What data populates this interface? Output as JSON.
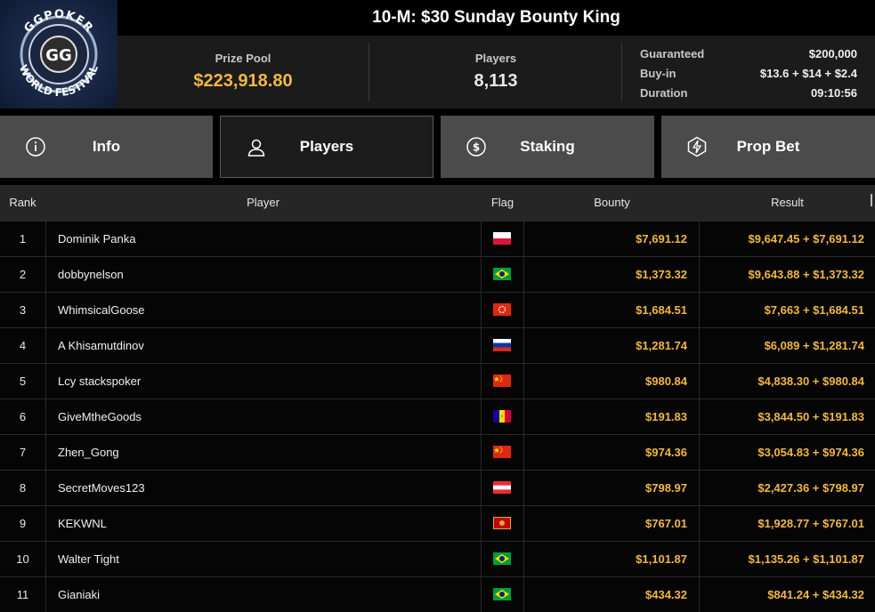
{
  "logo": {
    "top_text": "GGPOKER",
    "bottom_text": "WORLD FESTIVAL",
    "center_text": "GG"
  },
  "title": "10-M: $30 Sunday Bounty King",
  "stats": {
    "prize_pool_label": "Prize Pool",
    "prize_pool_value": "$223,918.80",
    "players_label": "Players",
    "players_value": "8,113",
    "guaranteed_label": "Guaranteed",
    "guaranteed_value": "$200,000",
    "buyin_label": "Buy-in",
    "buyin_value": "$13.6 + $14 + $2.4",
    "duration_label": "Duration",
    "duration_value": "09:10:56"
  },
  "tabs": [
    {
      "label": "Info",
      "icon": "info-icon",
      "active": false
    },
    {
      "label": "Players",
      "icon": "user-icon",
      "active": true
    },
    {
      "label": "Staking",
      "icon": "dollar-coin-icon",
      "active": false
    },
    {
      "label": "Prop Bet",
      "icon": "lightning-badge-icon",
      "active": false
    }
  ],
  "table": {
    "headers": {
      "rank": "Rank",
      "player": "Player",
      "flag": "Flag",
      "bounty": "Bounty",
      "result": "Result"
    },
    "rows": [
      {
        "rank": "1",
        "player": "Dominik Panka",
        "flag": "PL",
        "bounty": "$7,691.12",
        "result": "$9,647.45 + $7,691.12"
      },
      {
        "rank": "2",
        "player": "dobbynelson",
        "flag": "BR",
        "bounty": "$1,373.32",
        "result": "$9,643.88 + $1,373.32"
      },
      {
        "rank": "3",
        "player": "WhimsicalGoose",
        "flag": "HK",
        "bounty": "$1,684.51",
        "result": "$7,663 + $1,684.51"
      },
      {
        "rank": "4",
        "player": "A Khisamutdinov",
        "flag": "RU",
        "bounty": "$1,281.74",
        "result": "$6,089 + $1,281.74"
      },
      {
        "rank": "5",
        "player": "Lcy stackspoker",
        "flag": "CN",
        "bounty": "$980.84",
        "result": "$4,838.30 + $980.84"
      },
      {
        "rank": "6",
        "player": "GiveMtheGoods",
        "flag": "AD",
        "bounty": "$191.83",
        "result": "$3,844.50 + $191.83"
      },
      {
        "rank": "7",
        "player": "Zhen_Gong",
        "flag": "CN",
        "bounty": "$974.36",
        "result": "$3,054.83 + $974.36"
      },
      {
        "rank": "8",
        "player": "SecretMoves123",
        "flag": "AT",
        "bounty": "$798.97",
        "result": "$2,427.36 + $798.97"
      },
      {
        "rank": "9",
        "player": "KEKWNL",
        "flag": "ME",
        "bounty": "$767.01",
        "result": "$1,928.77 + $767.01"
      },
      {
        "rank": "10",
        "player": "Walter Tight",
        "flag": "BR",
        "bounty": "$1,101.87",
        "result": "$1,135.26 + $1,101.87"
      },
      {
        "rank": "11",
        "player": "Gianiaki",
        "flag": "BR",
        "bounty": "$434.32",
        "result": "$841.24 + $434.32"
      }
    ]
  },
  "colors": {
    "accent_gold": "#f2b744",
    "tab_bg": "#4b4b4b",
    "active_tab_bg": "#1c1c1c"
  }
}
